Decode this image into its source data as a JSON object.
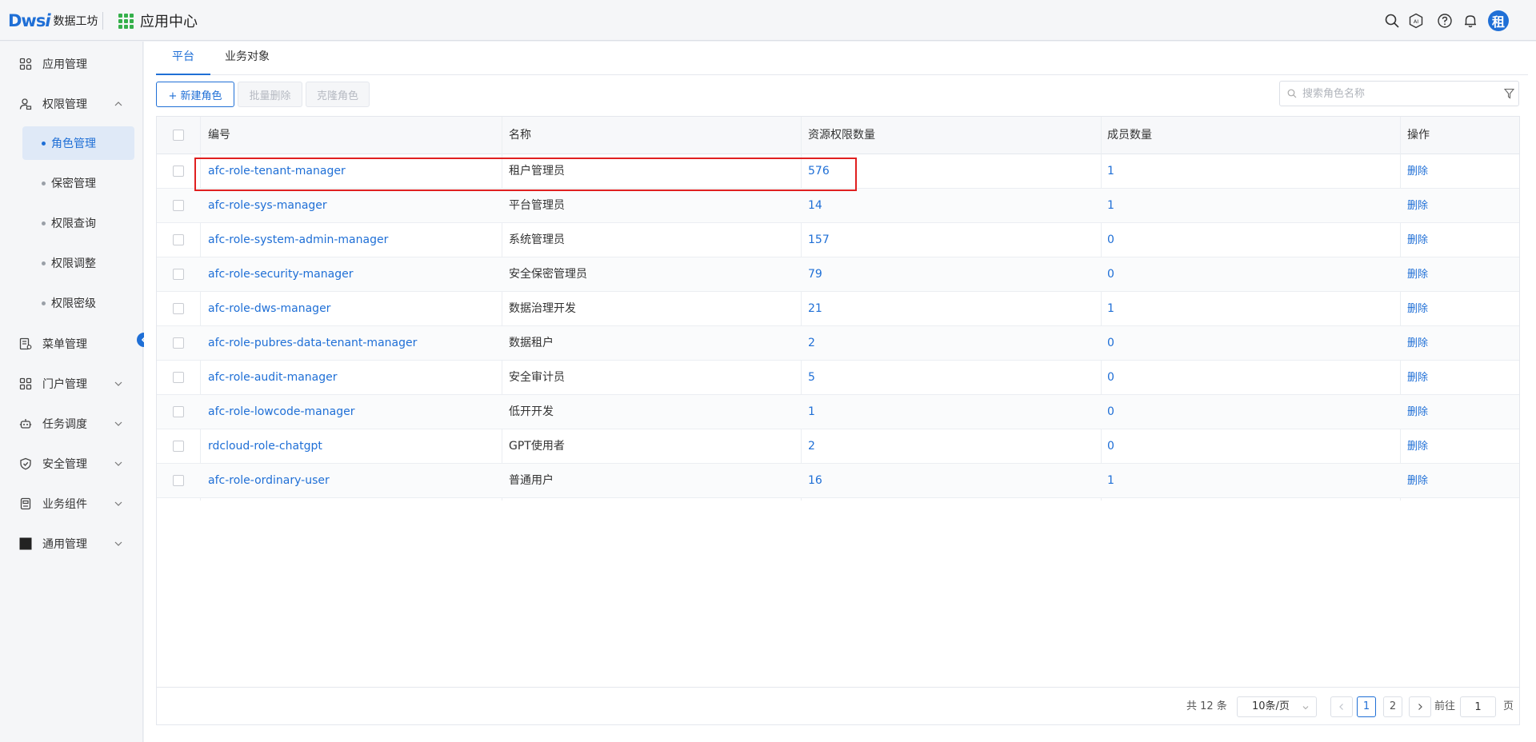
{
  "header": {
    "logo_mark": "Dws",
    "logo_mark_i": "i",
    "logo_text": "数据工坊",
    "app_title": "应用中心",
    "avatar_text": "租",
    "icons": [
      "search-icon",
      "ai-icon",
      "help-icon",
      "bell-icon"
    ]
  },
  "sidebar": {
    "items": [
      {
        "label": "应用管理",
        "icon": "app-grid-icon"
      },
      {
        "label": "权限管理",
        "icon": "user-lock-icon",
        "expanded": true
      },
      {
        "label": "菜单管理",
        "icon": "menu-doc-icon"
      },
      {
        "label": "门户管理",
        "icon": "portal-grid-icon"
      },
      {
        "label": "任务调度",
        "icon": "robot-icon"
      },
      {
        "label": "安全管理",
        "icon": "shield-icon"
      },
      {
        "label": "业务组件",
        "icon": "component-icon"
      },
      {
        "label": "通用管理",
        "icon": "square-icon"
      }
    ],
    "sub_items": [
      {
        "label": "角色管理",
        "active": true
      },
      {
        "label": "保密管理"
      },
      {
        "label": "权限查询"
      },
      {
        "label": "权限调整"
      },
      {
        "label": "权限密级"
      }
    ]
  },
  "tabs": [
    {
      "label": "平台",
      "active": true
    },
    {
      "label": "业务对象"
    }
  ],
  "toolbar": {
    "new_role": "+ 新建角色",
    "batch_delete": "批量删除",
    "clone_role": "克隆角色",
    "search_placeholder": "搜索角色名称"
  },
  "table": {
    "columns": [
      "编号",
      "名称",
      "资源权限数量",
      "成员数量",
      "操作"
    ],
    "rows": [
      {
        "code": "afc-role-tenant-manager",
        "name": "租户管理员",
        "resources": "576",
        "members": "1",
        "action": "删除"
      },
      {
        "code": "afc-role-sys-manager",
        "name": "平台管理员",
        "resources": "14",
        "members": "1",
        "action": "删除"
      },
      {
        "code": "afc-role-system-admin-manager",
        "name": "系统管理员",
        "resources": "157",
        "members": "0",
        "action": "删除"
      },
      {
        "code": "afc-role-security-manager",
        "name": "安全保密管理员",
        "resources": "79",
        "members": "0",
        "action": "删除"
      },
      {
        "code": "afc-role-dws-manager",
        "name": "数据治理开发",
        "resources": "21",
        "members": "1",
        "action": "删除"
      },
      {
        "code": "afc-role-pubres-data-tenant-manager",
        "name": "数据租户",
        "resources": "2",
        "members": "0",
        "action": "删除"
      },
      {
        "code": "afc-role-audit-manager",
        "name": "安全审计员",
        "resources": "5",
        "members": "0",
        "action": "删除"
      },
      {
        "code": "afc-role-lowcode-manager",
        "name": "低开开发",
        "resources": "1",
        "members": "0",
        "action": "删除"
      },
      {
        "code": "rdcloud-role-chatgpt",
        "name": "GPT使用者",
        "resources": "2",
        "members": "0",
        "action": "删除"
      },
      {
        "code": "afc-role-ordinary-user",
        "name": "普通用户",
        "resources": "16",
        "members": "1",
        "action": "删除"
      }
    ]
  },
  "pagination": {
    "total_text": "共 12 条",
    "page_size": "10条/页",
    "pages": [
      "1",
      "2"
    ],
    "current_page": "1",
    "goto_label": "前往",
    "goto_value": "1",
    "goto_unit": "页"
  },
  "colors": {
    "accent": "#1f6fd6",
    "highlight_border": "#e02020",
    "grid_icon": "#35b04b"
  }
}
